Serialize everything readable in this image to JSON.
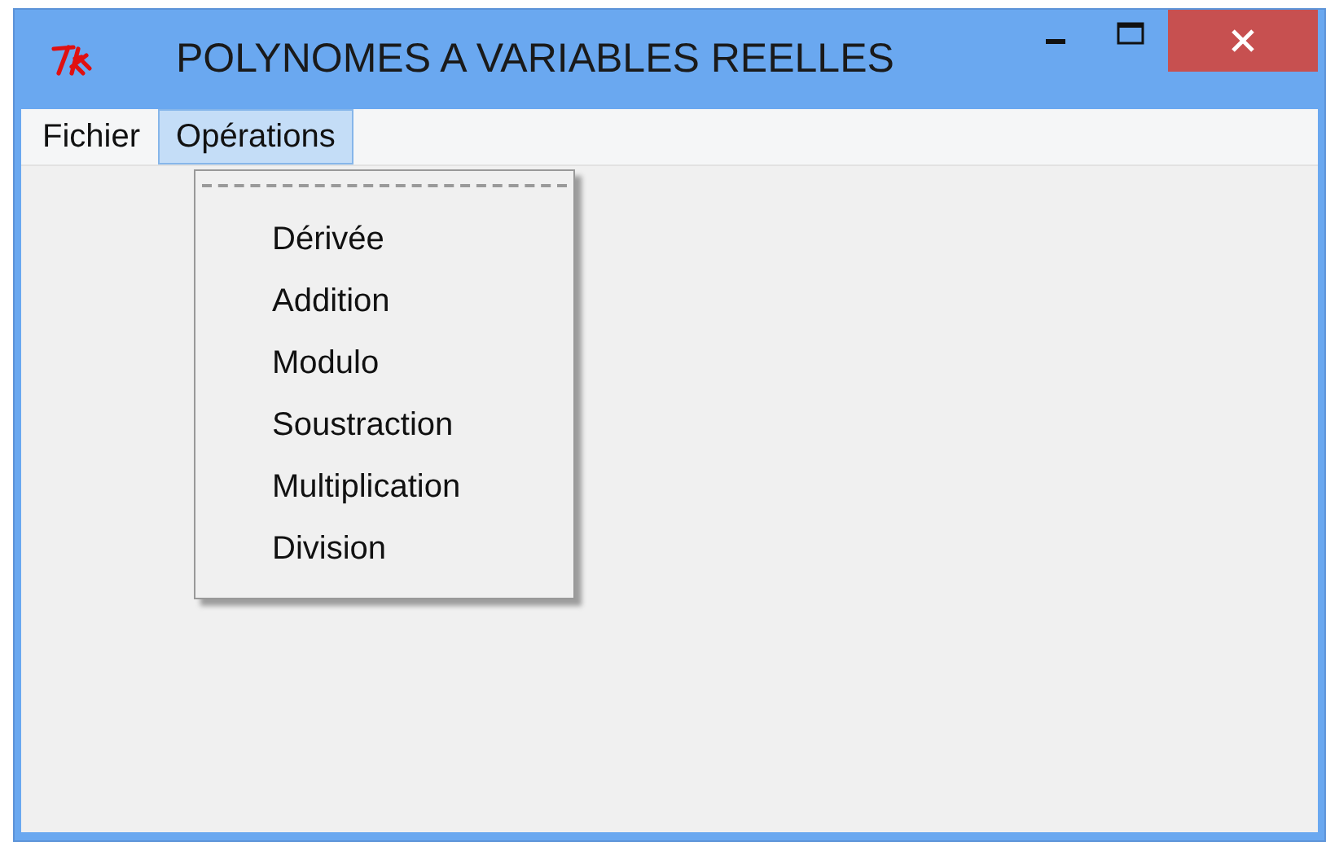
{
  "window": {
    "title": "POLYNOMES A VARIABLES REELLES"
  },
  "menubar": [
    {
      "label": "Fichier",
      "selected": false
    },
    {
      "label": "Opérations",
      "selected": true
    }
  ],
  "menu": {
    "tearoff": true,
    "items": [
      {
        "label": "Dérivée"
      },
      {
        "label": "Addition"
      },
      {
        "label": "Modulo"
      },
      {
        "label": "Soustraction"
      },
      {
        "label": "Multiplication"
      },
      {
        "label": "Division"
      }
    ]
  }
}
